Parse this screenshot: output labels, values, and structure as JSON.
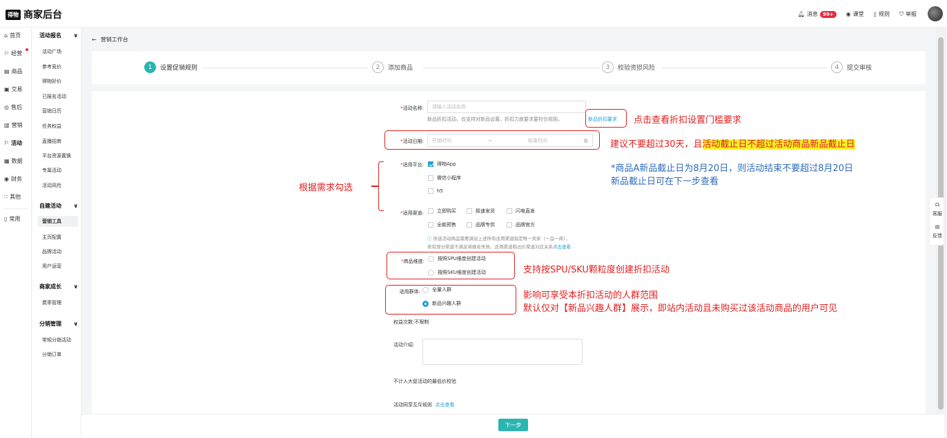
{
  "app": {
    "logo_badge": "得物",
    "title": "商家后台"
  },
  "topnav": {
    "messages": "消息",
    "messages_count": "99+",
    "classroom": "课堂",
    "rules": "规则",
    "report": "举报"
  },
  "side1": [
    "首页",
    "经营",
    "商品",
    "交易",
    "售后",
    "营销",
    "活动",
    "数据",
    "财务",
    "其他",
    "常用"
  ],
  "side2": {
    "g1": "活动报名",
    "g1_items": [
      "活动广场",
      "参考竞价",
      "得物好价",
      "已报名活动",
      "营销日历",
      "任务权益",
      "直播招商",
      "平台资源置换",
      "专属活动",
      "活动风险"
    ],
    "g2": "自建活动",
    "g2_items": [
      "营销工具",
      "主页配置",
      "品牌活动",
      "用户运营"
    ],
    "g3": "商家成长",
    "g3_items": [
      "费率管理"
    ],
    "g4": "分销管理",
    "g4_items": [
      "常规分销活动",
      "分销订单"
    ]
  },
  "back": "营销工作台",
  "steps": [
    {
      "num": "1",
      "label": "设置促销规则"
    },
    {
      "num": "2",
      "label": "添加商品"
    },
    {
      "num": "3",
      "label": "校验资损风险"
    },
    {
      "num": "4",
      "label": "提交审核"
    }
  ],
  "form": {
    "name_label": "活动名称:",
    "name_placeholder": "请输入活动名称",
    "name_hint": "新品折扣活动，仅支持对新品设置，折扣力度要求要符合规则。",
    "name_link": "新品折扣要求",
    "date_label": "活动日期:",
    "date_start": "开始时间",
    "date_end": "结束时间",
    "platform_label": "适用平台:",
    "platforms": [
      "得物App",
      "微信小程序",
      "h5"
    ],
    "channel_label": "适用渠道:",
    "channels_r1": [
      "立即购买",
      "极速发货",
      "闪电直发"
    ],
    "channels_r2": [
      "全款预售",
      "品牌专供",
      "品牌官方"
    ],
    "channel_hint1": "所选活动商品需要满足上述所有适用渠道指定唯一卖家（一品一商），",
    "channel_hint2": "若有部分渠道不满足将报名失败。适用渠道和出价渠道对应关系",
    "channel_hint_link": "点击查看",
    "dim_label": "商品维度:",
    "dims": [
      "按照SPU维度创建活动",
      "按照SKU维度创建活动"
    ],
    "crowd_label": "适用群体:",
    "crowds": [
      "全量人群",
      "新品兴趣人群"
    ],
    "times_label": "权益次数:",
    "times_value": "不限制",
    "intro_label": "活动介绍:",
    "lowest": "不计入大促活动的最低价校验",
    "mutex_label": "活动同享互斥规则",
    "mutex_link": "点击查看"
  },
  "next": "下一步",
  "float": {
    "service": "客服",
    "feedback": "反馈"
  },
  "annotations": {
    "a1": "点击查看折扣设置门槛要求",
    "a2_pre": "建议不要超过30天，且",
    "a2_hl": "活动截止日不超过活动商品新品截止日",
    "a3": "*商品A新品截止日为8月20日，则活动结束不要超过8月20日",
    "a4": "新品截止日可在下一步查看",
    "a5": "根据需求勾选",
    "a6": "支持按SPU/SKU颗粒度创建折扣活动",
    "a7": "影响可享受本折扣活动的人群范围",
    "a8": "默认仅对【新品兴趣人群】展示，即站内活动且未购买过该活动商品的用户可见"
  }
}
